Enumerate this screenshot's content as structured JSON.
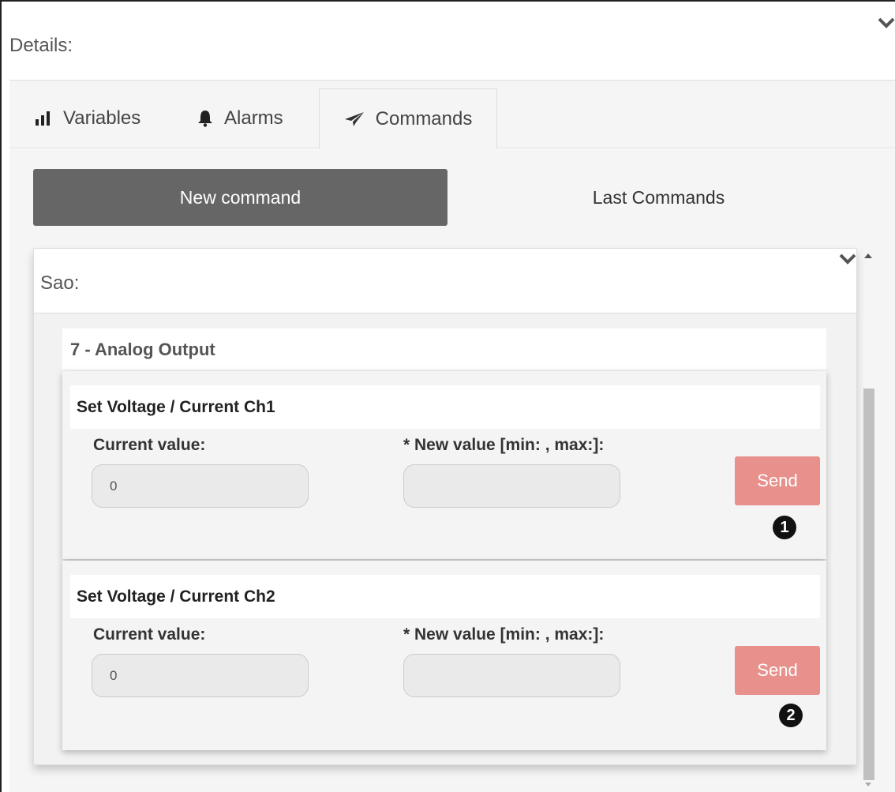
{
  "details": {
    "title": "Details:"
  },
  "tabs": [
    {
      "label": "Variables",
      "icon": "bar-chart-icon"
    },
    {
      "label": "Alarms",
      "icon": "bell-icon"
    },
    {
      "label": "Commands",
      "icon": "paper-plane-icon",
      "active": true
    }
  ],
  "segment": {
    "new_command": "New command",
    "last_commands": "Last Commands"
  },
  "sao": {
    "title": "Sao:"
  },
  "analog_output": {
    "title": "7 - Analog Output"
  },
  "commands": [
    {
      "title": "Set Voltage / Current Ch1",
      "current_label": "Current value:",
      "current_value": "0",
      "new_label": "* New value [min: , max:]:",
      "new_value": "",
      "send_label": "Send",
      "badge": "1"
    },
    {
      "title": "Set Voltage / Current Ch2",
      "current_label": "Current value:",
      "current_value": "0",
      "new_label": "* New value [min: , max:]:",
      "new_value": "",
      "send_label": "Send",
      "badge": "2"
    }
  ],
  "colors": {
    "active_segment": "#666666",
    "send_button": "#e8908c",
    "panel_bg": "#f5f5f5"
  }
}
